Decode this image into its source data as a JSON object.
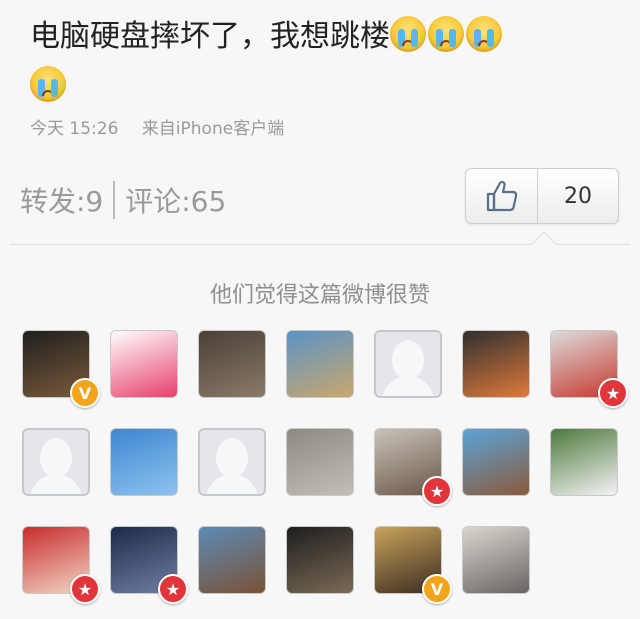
{
  "post": {
    "text": "电脑硬盘摔坏了，我想跳楼",
    "emojis": [
      "crying-face-icon",
      "crying-face-icon",
      "crying-face-icon",
      "crying-face-icon"
    ],
    "time": "今天 15:26",
    "source": "来自iPhone客户端"
  },
  "stats": {
    "repost": "转发:9",
    "comment": "评论:65"
  },
  "like": {
    "icon": "thumbs-up-icon",
    "count": "20"
  },
  "likers": {
    "title": "他们觉得这篇微博很赞",
    "avatars": [
      {
        "name": "avatar-1",
        "badge": "v",
        "colors": [
          "#1f1f1f",
          "#7a5a3a"
        ]
      },
      {
        "name": "avatar-2",
        "badge": "",
        "colors": [
          "#ffffff",
          "#e63f6b"
        ]
      },
      {
        "name": "avatar-3",
        "badge": "",
        "colors": [
          "#4a4038",
          "#8a7a68"
        ]
      },
      {
        "name": "avatar-4",
        "badge": "",
        "colors": [
          "#5b93c7",
          "#c9a76b"
        ]
      },
      {
        "name": "avatar-5",
        "badge": "",
        "colors": [
          "#e4e6ea",
          "#e4e6ea"
        ]
      },
      {
        "name": "avatar-6",
        "badge": "",
        "colors": [
          "#2f2f2f",
          "#e07a3a"
        ]
      },
      {
        "name": "avatar-7",
        "badge": "star",
        "colors": [
          "#dcdcdc",
          "#c7392f"
        ]
      },
      {
        "name": "avatar-8",
        "badge": "",
        "colors": [
          "#e4e6ea",
          "#e4e6ea"
        ]
      },
      {
        "name": "avatar-9",
        "badge": "",
        "colors": [
          "#3d86d1",
          "#8ec3ef"
        ]
      },
      {
        "name": "avatar-10",
        "badge": "",
        "colors": [
          "#e4e6ea",
          "#e4e6ea"
        ]
      },
      {
        "name": "avatar-11",
        "badge": "",
        "colors": [
          "#8c8a84",
          "#c3bfb6"
        ]
      },
      {
        "name": "avatar-12",
        "badge": "star",
        "colors": [
          "#c9c3bb",
          "#6b5748"
        ]
      },
      {
        "name": "avatar-13",
        "badge": "",
        "colors": [
          "#5aa4d8",
          "#8a5a3a"
        ]
      },
      {
        "name": "avatar-14",
        "badge": "",
        "colors": [
          "#4e7a3e",
          "#f3f3f3"
        ]
      },
      {
        "name": "avatar-15",
        "badge": "star",
        "colors": [
          "#c82c2c",
          "#f1d7c6"
        ]
      },
      {
        "name": "avatar-16",
        "badge": "star",
        "colors": [
          "#1d2b49",
          "#6f7ea4"
        ]
      },
      {
        "name": "avatar-17",
        "badge": "",
        "colors": [
          "#5c8bb5",
          "#7a5236"
        ]
      },
      {
        "name": "avatar-18",
        "badge": "",
        "colors": [
          "#1e1e1e",
          "#7b6a56"
        ]
      },
      {
        "name": "avatar-19",
        "badge": "v",
        "colors": [
          "#c9a35a",
          "#3b2c22"
        ]
      },
      {
        "name": "avatar-20",
        "badge": "",
        "colors": [
          "#d9d6d0",
          "#6a6460"
        ]
      }
    ]
  }
}
